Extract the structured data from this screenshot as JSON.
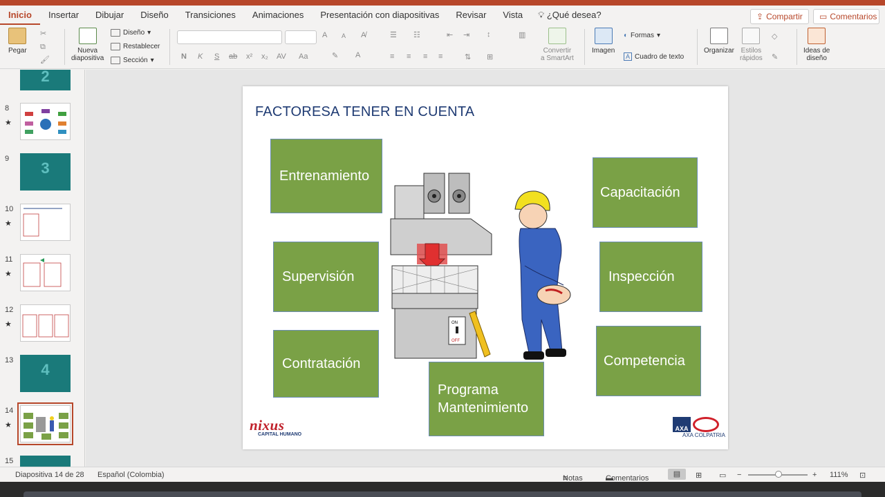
{
  "menu": {
    "tabs": [
      "Inicio",
      "Insertar",
      "Dibujar",
      "Diseño",
      "Transiciones",
      "Animaciones",
      "Presentación con diapositivas",
      "Revisar",
      "Vista"
    ],
    "active_tab": "Inicio",
    "tell_me": "¿Qué desea?",
    "share": "Compartir",
    "comments": "Comentarios"
  },
  "ribbon": {
    "paste": "Pegar",
    "new_slide_1": "Nueva",
    "new_slide_2": "diapositiva",
    "layout": "Diseño",
    "reset": "Restablecer",
    "section": "Sección",
    "convert_1": "Convertir",
    "convert_2": "a SmartArt",
    "image": "Imagen",
    "shapes": "Formas",
    "textbox": "Cuadro de texto",
    "arrange": "Organizar",
    "quick_styles_1": "Estilos",
    "quick_styles_2": "rápidos",
    "design_ideas_1": "Ideas de",
    "design_ideas_2": "diseño",
    "format_glyphs": {
      "bold": "N",
      "italic": "K",
      "underline": "S",
      "strike": "ab",
      "super": "x²",
      "sub": "x₂",
      "spacing": "AV",
      "case": "Aa",
      "grow": "A",
      "shrink": "A"
    }
  },
  "thumbnails": [
    {
      "num": "8",
      "star": "★"
    },
    {
      "num": "9",
      "star": "",
      "big": "3"
    },
    {
      "num": "10",
      "star": "★"
    },
    {
      "num": "11",
      "star": "★"
    },
    {
      "num": "12",
      "star": "★"
    },
    {
      "num": "13",
      "star": "",
      "big": "4"
    },
    {
      "num": "14",
      "star": "★"
    },
    {
      "num": "15",
      "star": ""
    }
  ],
  "top_thumb_big": "2",
  "slide": {
    "title": "FACTORESA TENER EN CUENTA",
    "boxes": {
      "entrenamiento": "Entrenamiento",
      "supervision": "Supervisión",
      "contratacion": "Contratación",
      "programa_1": "Programa",
      "programa_2": "Mantenimiento",
      "capacitacion": "Capacitación",
      "inspeccion": "Inspección",
      "competencia": "Competencia"
    },
    "machine_on": "ON",
    "machine_off": "OFF",
    "logo_left": "nixus",
    "logo_left_sub": "CAPITAL HUMANO",
    "logo_right_sub": "AXA COLPATRIA",
    "logo_right_axa": "AXA"
  },
  "status": {
    "slide_count": "Diapositiva 14 de 28",
    "language": "Español (Colombia)",
    "notes": "Notas",
    "comments": "Comentarios",
    "zoom": "111%"
  }
}
